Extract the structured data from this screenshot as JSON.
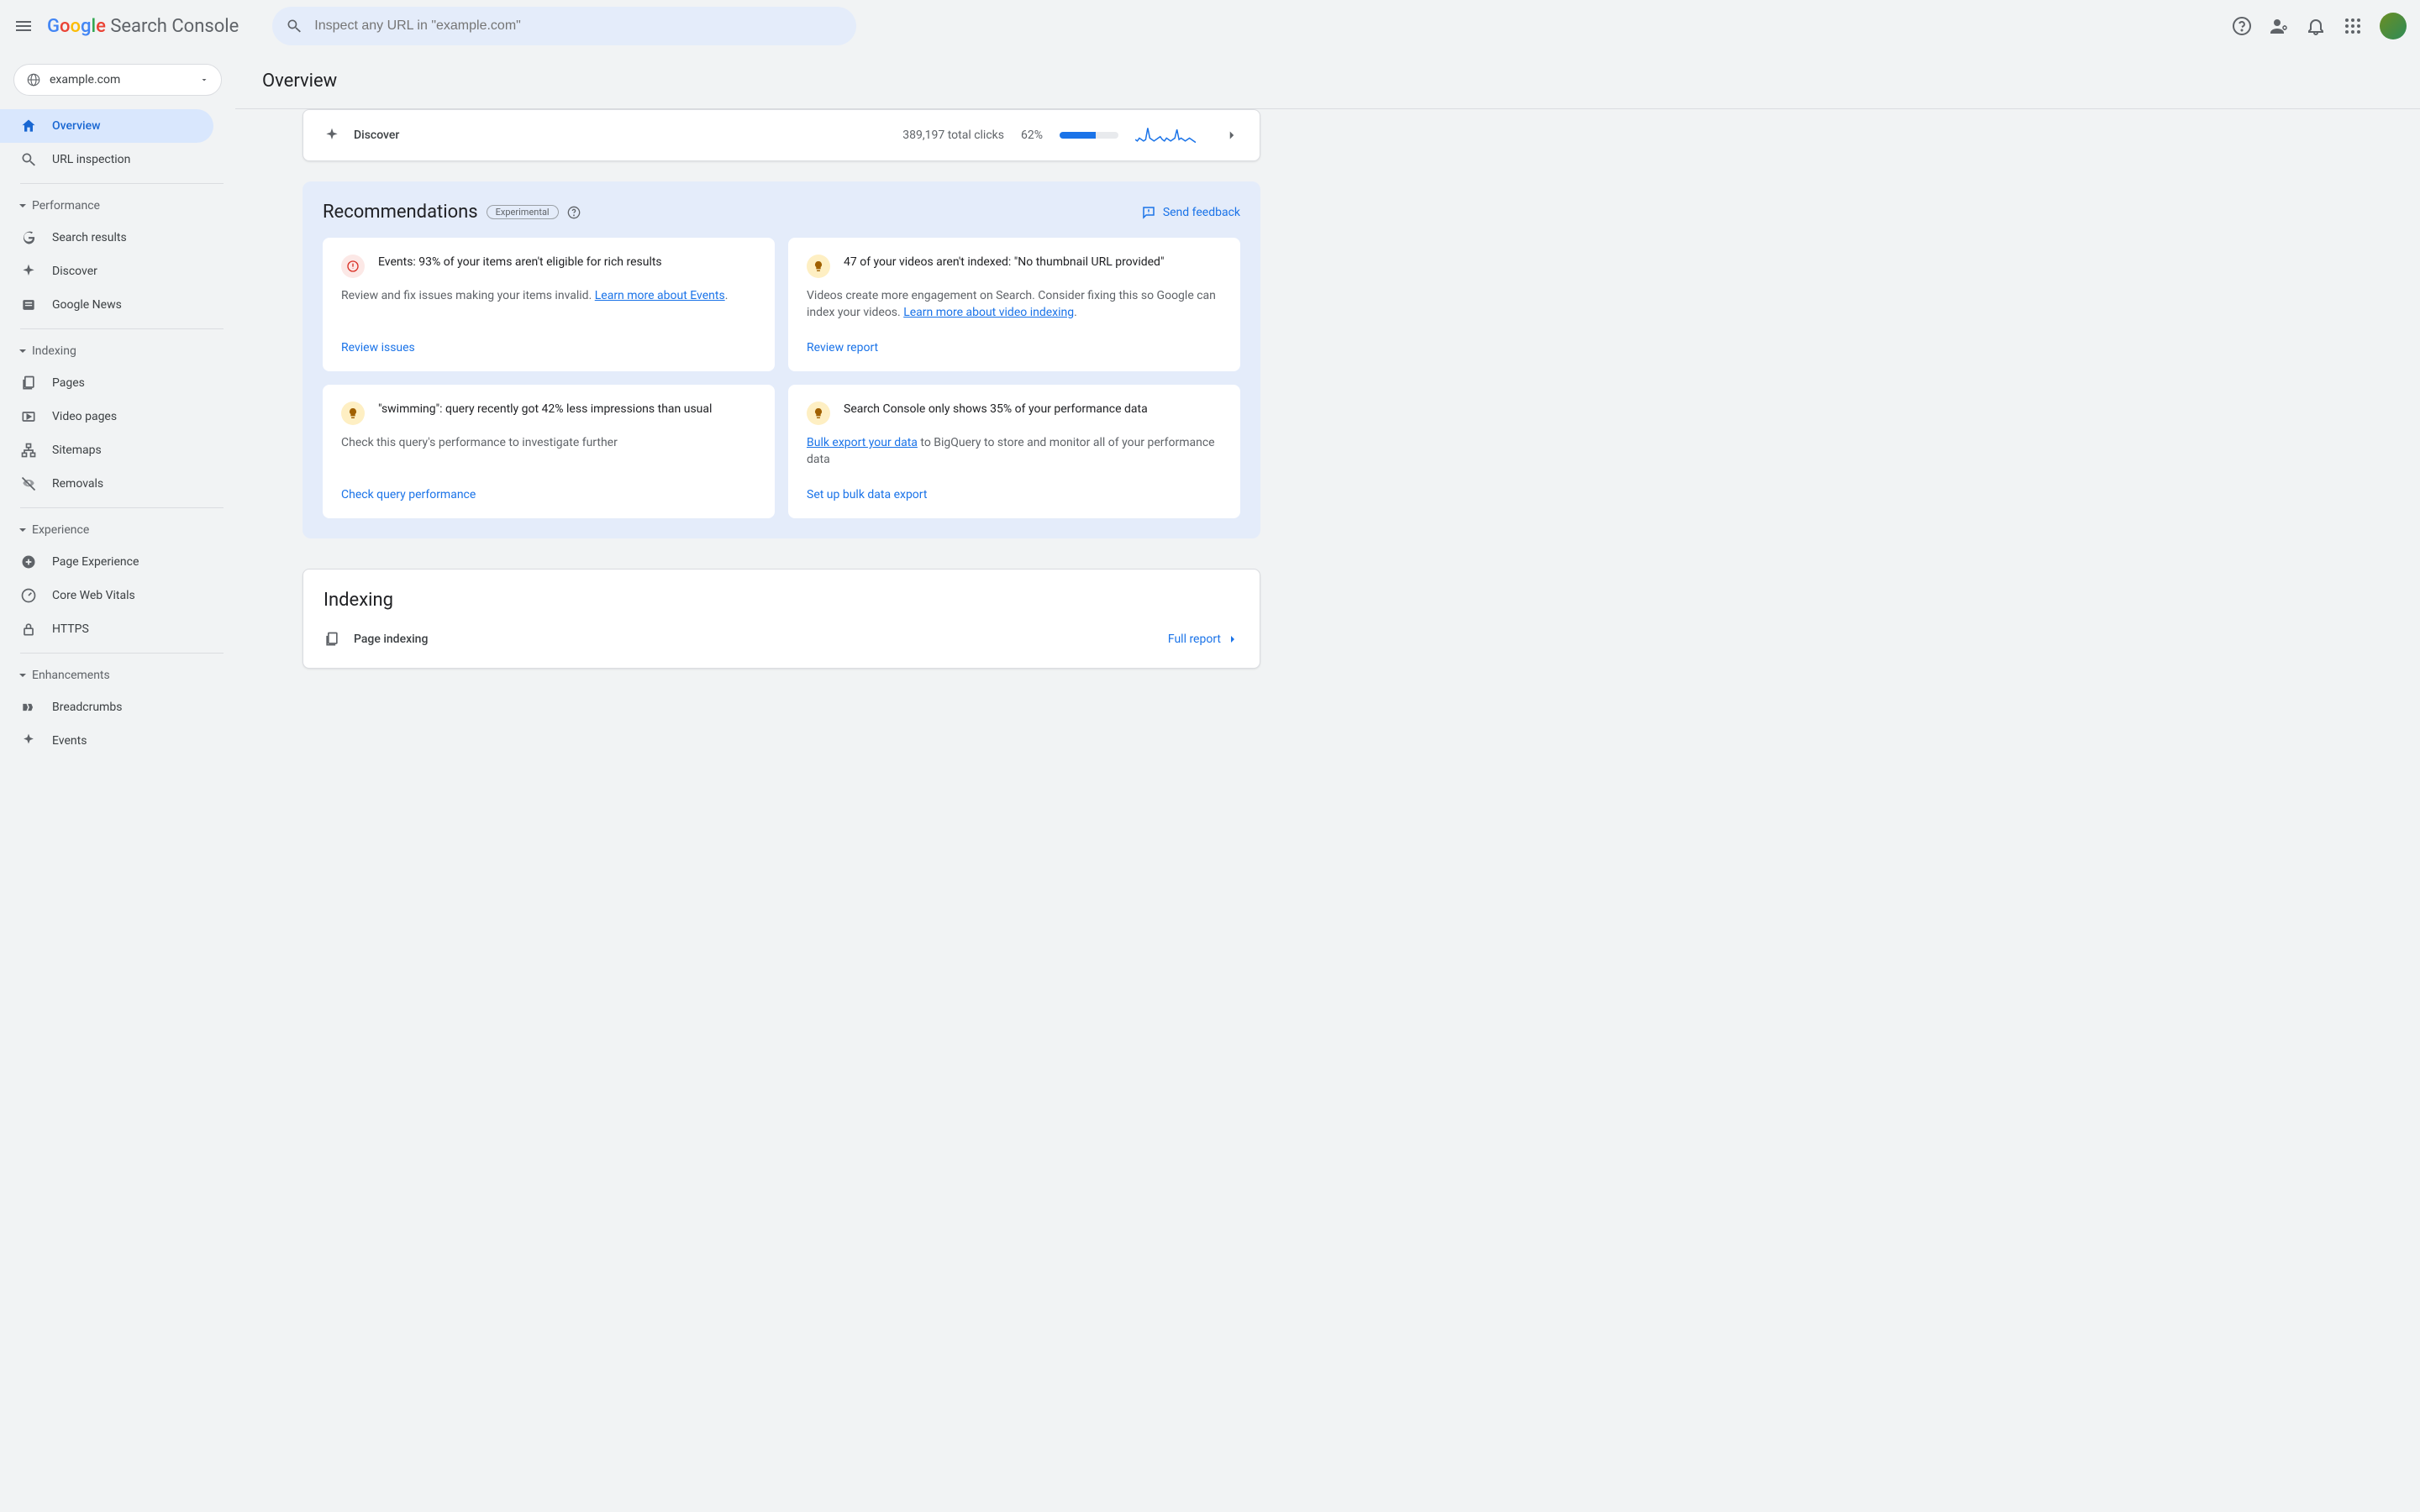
{
  "header": {
    "brand_product": "Search Console",
    "search_placeholder": "Inspect any URL in \"example.com\""
  },
  "property": {
    "name": "example.com"
  },
  "nav": {
    "overview": "Overview",
    "url_inspection": "URL inspection",
    "sections": {
      "performance": "Performance",
      "indexing": "Indexing",
      "experience": "Experience",
      "enhancements": "Enhancements"
    },
    "performance_items": {
      "search_results": "Search results",
      "discover": "Discover",
      "google_news": "Google News"
    },
    "indexing_items": {
      "pages": "Pages",
      "video_pages": "Video pages",
      "sitemaps": "Sitemaps",
      "removals": "Removals"
    },
    "experience_items": {
      "page_experience": "Page Experience",
      "core_web_vitals": "Core Web Vitals",
      "https": "HTTPS"
    },
    "enhancements_items": {
      "breadcrumbs": "Breadcrumbs",
      "events": "Events"
    }
  },
  "page": {
    "title": "Overview"
  },
  "discover": {
    "label": "Discover",
    "clicks": "389,197 total clicks",
    "percent_text": "62%",
    "percent_value": 62
  },
  "recommendations": {
    "title": "Recommendations",
    "badge": "Experimental",
    "feedback": "Send feedback",
    "cards": [
      {
        "icon": "error",
        "title": "Events: 93% of your items aren't eligible for rich results",
        "desc_pre": "Review and fix issues making your items invalid. ",
        "link": "Learn more about Events",
        "desc_post": ".",
        "action": "Review issues"
      },
      {
        "icon": "tip",
        "title": "47 of your videos aren't indexed: \"No thumbnail URL provided\"",
        "desc_pre": "Videos create more engagement on Search. Consider fixing this so Google can index your videos. ",
        "link": "Learn more about video indexing",
        "desc_post": ".",
        "action": "Review report"
      },
      {
        "icon": "tip",
        "title": "\"swimming\": query recently got 42% less impressions than usual",
        "desc_pre": "Check this query's performance to investigate further",
        "link": "",
        "desc_post": "",
        "action": "Check query performance"
      },
      {
        "icon": "tip",
        "title": "Search Console only shows 35% of your performance data",
        "desc_pre": "",
        "link": "Bulk export your data",
        "desc_post": " to BigQuery to store and monitor all of your performance data",
        "action": "Set up bulk data export"
      }
    ]
  },
  "indexing_section": {
    "title": "Indexing",
    "row_label": "Page indexing",
    "full_report": "Full report"
  },
  "chart_data": {
    "type": "line",
    "title": "Discover clicks sparkline",
    "x": [
      0,
      1,
      2,
      3,
      4,
      5,
      6,
      7,
      8,
      9,
      10,
      11,
      12,
      13,
      14,
      15,
      16,
      17,
      18,
      19,
      20,
      21,
      22,
      23,
      24,
      25,
      26,
      27,
      28,
      29
    ],
    "values": [
      4,
      3,
      5,
      4,
      3,
      4,
      12,
      5,
      4,
      3,
      4,
      5,
      6,
      4,
      3,
      5,
      4,
      3,
      4,
      5,
      11,
      4,
      5,
      4,
      3,
      4,
      5,
      4,
      3,
      2
    ],
    "ylim": [
      0,
      14
    ]
  }
}
